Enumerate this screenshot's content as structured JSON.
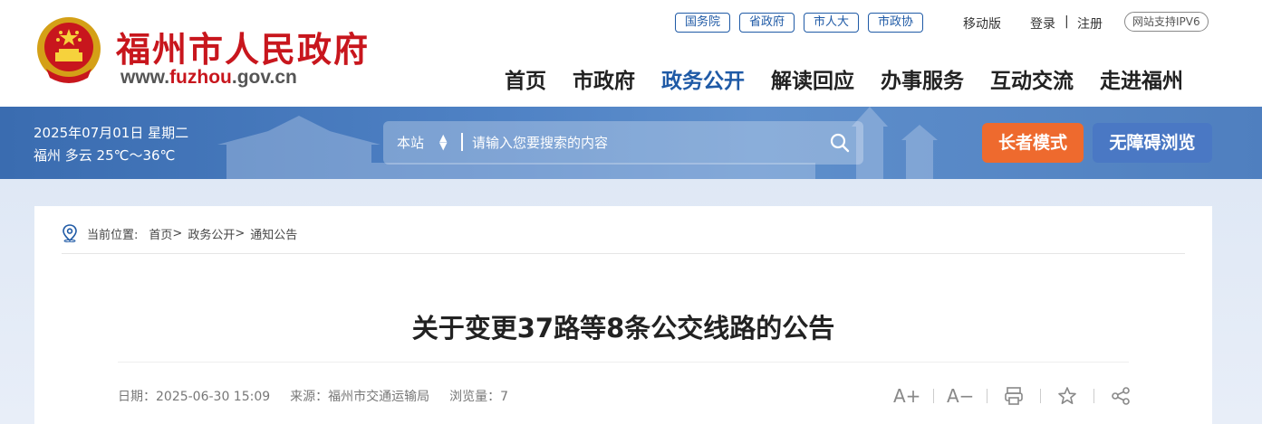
{
  "header": {
    "site_title": "福州市人民政府",
    "url_prefix": "www.",
    "url_highlight": "fuzhou",
    "url_suffix": ".gov.cn",
    "top_links": [
      "国务院",
      "省政府",
      "市人大",
      "市政协"
    ],
    "mobile": "移动版",
    "login": "登录",
    "separator": "|",
    "register": "注册",
    "ipv6": "网站支持IPV6",
    "nav": [
      "首页",
      "市政府",
      "政务公开",
      "解读回应",
      "办事服务",
      "互动交流",
      "走进福州"
    ],
    "active_nav": "政务公开"
  },
  "banner": {
    "date": "2025年07月01日 星期二",
    "weather": "福州 多云 25℃～36℃",
    "search_scope": "本站",
    "search_placeholder": "请输入您要搜索的内容",
    "elder_mode": "长者模式",
    "accessible": "无障碍浏览"
  },
  "breadcrumb": {
    "label": "当前位置:",
    "items": [
      "首页",
      ">",
      "政务公开",
      ">",
      "通知公告"
    ]
  },
  "article": {
    "title": "关于变更37路等8条公交线路的公告",
    "date": "日期：2025-06-30 15:09",
    "source": "来源：福州市交通运输局",
    "views": "浏览量：7"
  },
  "tools": {
    "font_larger": "A+",
    "font_smaller": "A−"
  },
  "colors": {
    "brand_red": "#c8161d",
    "brand_blue": "#1f5aa6",
    "elder_orange": "#ee6a2e"
  }
}
